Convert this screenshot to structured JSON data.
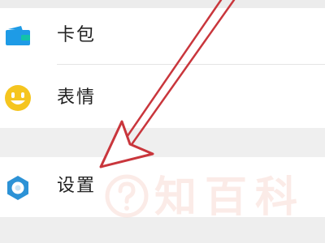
{
  "menu": {
    "items": [
      {
        "label": "卡包",
        "icon": "wallet-icon"
      },
      {
        "label": "表情",
        "icon": "smiley-icon"
      },
      {
        "label": "设置",
        "icon": "settings-gear-icon"
      }
    ]
  },
  "annotation": {
    "icon": "red-arrow-pointer"
  },
  "watermark": {
    "text": "知百科",
    "icon": "question-mark-logo-icon"
  },
  "colors": {
    "wallet_icon": "#1e9be6",
    "smiley_icon": "#f5c51f",
    "settings_icon": "#2c92d6",
    "arrow": "#c9363c",
    "watermark": "#f4b9ac",
    "separator": "#efefef"
  }
}
